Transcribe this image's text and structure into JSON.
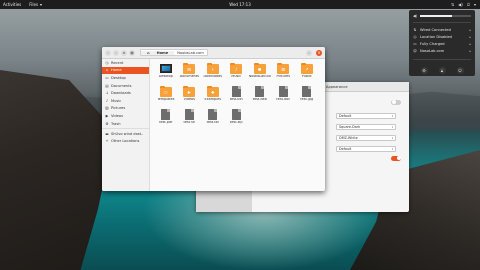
{
  "topbar": {
    "activities": "Activities",
    "app_name": "Files",
    "clock": "Wed 17:13"
  },
  "system_menu": {
    "volume_level": 0.62,
    "items": [
      {
        "label": "Wired Connected",
        "icon": "network-icon"
      },
      {
        "label": "Location Disabled",
        "icon": "location-icon"
      },
      {
        "label": "Fully Charged",
        "icon": "battery-icon"
      },
      {
        "label": "NosoLab.com",
        "icon": "user-icon"
      }
    ]
  },
  "files": {
    "breadcrumb": [
      "Home",
      "NoobsLab.com"
    ],
    "sidebar": [
      {
        "label": "Recent",
        "icon": "clock-icon"
      },
      {
        "label": "Home",
        "icon": "home-icon",
        "selected": true
      },
      {
        "label": "Desktop",
        "icon": "desktop-icon"
      },
      {
        "label": "Documents",
        "icon": "document-icon"
      },
      {
        "label": "Downloads",
        "icon": "download-icon"
      },
      {
        "label": "Music",
        "icon": "music-icon"
      },
      {
        "label": "Pictures",
        "icon": "picture-icon"
      },
      {
        "label": "Videos",
        "icon": "video-icon"
      },
      {
        "label": "Trash",
        "icon": "trash-icon"
      }
    ],
    "sidebar_extra": [
      {
        "label": "ShUvo wind dost..",
        "icon": "drive-icon"
      },
      {
        "label": "Other Locations",
        "icon": "plus-icon"
      }
    ],
    "items": [
      {
        "name": "Desktop",
        "type": "monitor"
      },
      {
        "name": "Documents",
        "type": "folder"
      },
      {
        "name": "Downloads",
        "type": "folder"
      },
      {
        "name": "Music",
        "type": "folder"
      },
      {
        "name": "NoobsLab.com",
        "type": "folder"
      },
      {
        "name": "Pictures",
        "type": "folder"
      },
      {
        "name": "Public",
        "type": "folder"
      },
      {
        "name": "Templates",
        "type": "folder"
      },
      {
        "name": "Videos",
        "type": "folder"
      },
      {
        "name": "Examples",
        "type": "folder"
      },
      {
        "name": "test.bin",
        "type": "file"
      },
      {
        "name": "test.deb",
        "type": "file"
      },
      {
        "name": "test.doc",
        "type": "file"
      },
      {
        "name": "test.jpg",
        "type": "file"
      },
      {
        "name": "test.pdf",
        "type": "file"
      },
      {
        "name": "test.sh",
        "type": "file"
      },
      {
        "name": "test.txt",
        "type": "file"
      },
      {
        "name": "test.zip",
        "type": "file"
      }
    ]
  },
  "settings": {
    "title": "Appearance",
    "rows": [
      {
        "kind": "dropdown",
        "value": "Default"
      },
      {
        "kind": "dropdown",
        "value": "Square-Dark"
      },
      {
        "kind": "dropdown",
        "value": "DMZ-White"
      },
      {
        "kind": "dropdown",
        "value": "Default"
      }
    ]
  },
  "colors": {
    "accent": "#e95420",
    "folder": "#f6a13a",
    "topbar": "#1d1d1d"
  }
}
